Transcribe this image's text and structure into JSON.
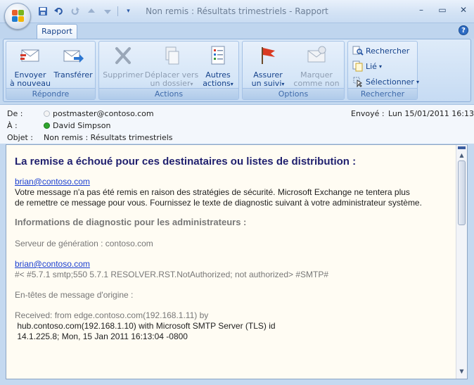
{
  "window": {
    "title": "Non remis : Résultats trimestriels - Rapport",
    "controls": {
      "minimize": "–",
      "restore": "▭",
      "close": "✕"
    }
  },
  "quick_access": {
    "more": "▾"
  },
  "tabs": [
    {
      "label": "Rapport",
      "selected": true
    }
  ],
  "help": {
    "label": "?"
  },
  "ribbon": {
    "groups": {
      "repondre": {
        "label": "Répondre",
        "buttons": [
          {
            "line1": "Envoyer",
            "line2": "à nouveau",
            "icon": "resend-icon"
          },
          {
            "line1": "Transférer",
            "line2": "",
            "icon": "forward-icon"
          }
        ]
      },
      "actions": {
        "label": "Actions",
        "buttons": [
          {
            "line1": "Supprimer",
            "line2": "",
            "icon": "delete-icon",
            "enabled": false
          },
          {
            "line1": "Déplacer vers",
            "line2": "un dossier",
            "caret": "▾",
            "icon": "move-to-folder-icon",
            "enabled": false
          },
          {
            "line1": "Autres",
            "line2": "actions",
            "caret": "▾",
            "icon": "other-actions-icon",
            "enabled": true
          }
        ]
      },
      "options": {
        "label": "Options",
        "buttons": [
          {
            "line1": "Assurer",
            "line2": "un suivi",
            "caret": "▾",
            "icon": "follow-up-flag-icon",
            "enabled": true
          },
          {
            "line1": "Marquer",
            "line2": "comme non lu",
            "icon": "mark-unread-icon",
            "enabled": false
          }
        ]
      },
      "rechercher": {
        "label": "Rechercher",
        "buttons": [
          {
            "label": "Rechercher",
            "icon": "find-icon"
          },
          {
            "label": "Lié",
            "caret": "▾",
            "icon": "related-icon"
          },
          {
            "label": "Sélectionner",
            "caret": "▾",
            "icon": "select-icon"
          }
        ]
      }
    }
  },
  "headers": {
    "from_label": "De :",
    "from_value": "postmaster@contoso.com",
    "to_label": "À :",
    "to_value": "David Simpson",
    "subject_label": "Objet :",
    "subject_value": "Non remis : Résultats trimestriels",
    "sent_label": "Envoyé :",
    "sent_value": "Lun 15/01/2011 16:13"
  },
  "message": {
    "heading": "La remise a échoué pour ces destinataires ou listes de distribution :",
    "recipient_link": "brian@contoso.com",
    "explanation_1": "Votre message n'a pas été remis en raison des stratégies de sécurité. Microsoft Exchange ne tentera plus",
    "explanation_2": "de remettre ce message pour vous. Fournissez le texte de diagnostic suivant à votre administrateur système.",
    "diag_heading": "Informations de diagnostic pour les administrateurs :",
    "gen_server": "Serveur de génération : contoso.com",
    "diag_link": "brian@contoso.com",
    "diag_code": "#< #5.7.1 smtp;550 5.7.1 RESOLVER.RST.NotAuthorized; not authorized> #SMTP#",
    "orig_headers": "En-têtes de message d'origine :",
    "received_1": "Received: from edge.contoso.com(192.168.1.11) by",
    "received_2": " hub.contoso.com(192.168.1.10) with Microsoft SMTP Server (TLS) id",
    "received_3": " 14.1.225.8; Mon, 15 Jan 2011 16:13:04 -0800"
  },
  "colors": {
    "ribbon_text": "#15428b",
    "group_label": "#3e6aaa",
    "link": "#1a3fd1",
    "heading": "#1f1f6e",
    "presence_online": "#2ea52e"
  }
}
